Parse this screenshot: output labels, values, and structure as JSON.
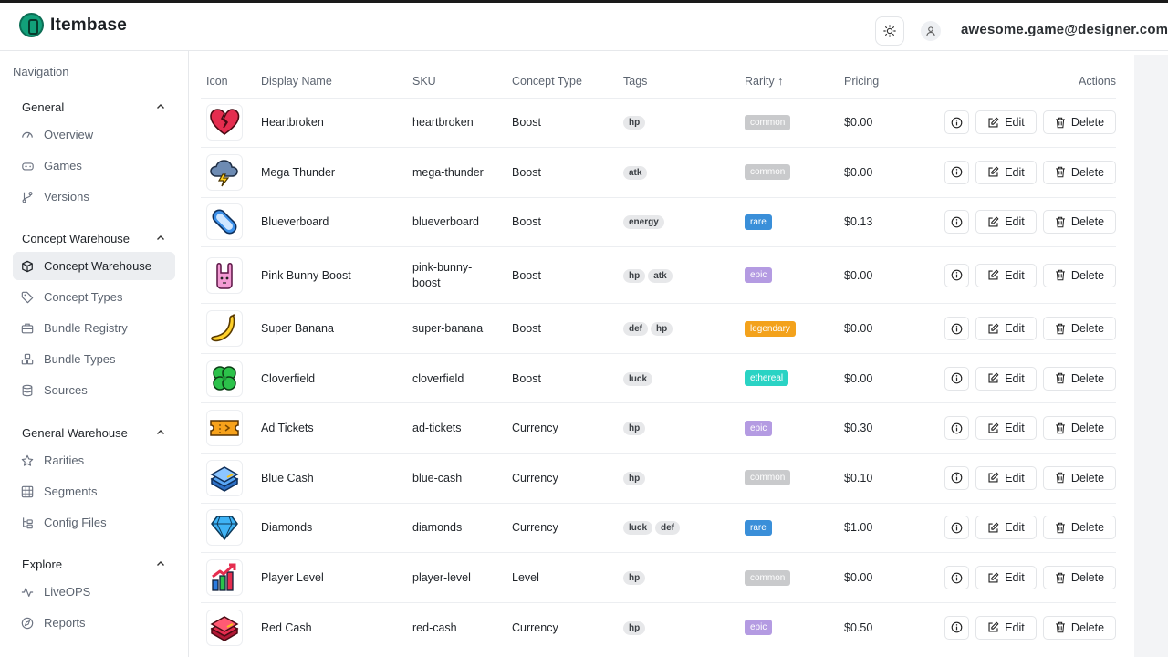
{
  "app": {
    "name": "Itembase",
    "user_email": "awesome.game@designer.com"
  },
  "nav": {
    "title": "Navigation",
    "sections": [
      {
        "label": "General",
        "items": [
          {
            "label": "Overview",
            "icon": "gauge-icon"
          },
          {
            "label": "Games",
            "icon": "gamepad-icon"
          },
          {
            "label": "Versions",
            "icon": "git-branch-icon"
          }
        ]
      },
      {
        "label": "Concept Warehouse",
        "items": [
          {
            "label": "Concept Warehouse",
            "icon": "cube-icon",
            "active": true
          },
          {
            "label": "Concept Types",
            "icon": "tag-icon"
          },
          {
            "label": "Bundle Registry",
            "icon": "briefcase-icon"
          },
          {
            "label": "Bundle Types",
            "icon": "boxes-icon"
          },
          {
            "label": "Sources",
            "icon": "database-icon"
          }
        ]
      },
      {
        "label": "General Warehouse",
        "items": [
          {
            "label": "Rarities",
            "icon": "star-icon"
          },
          {
            "label": "Segments",
            "icon": "grid-icon"
          },
          {
            "label": "Config Files",
            "icon": "file-tree-icon"
          }
        ]
      },
      {
        "label": "Explore",
        "items": [
          {
            "label": "LiveOPS",
            "icon": "activity-icon"
          },
          {
            "label": "Reports",
            "icon": "compass-icon"
          }
        ]
      }
    ]
  },
  "table": {
    "columns": {
      "icon": "Icon",
      "name": "Display Name",
      "sku": "SKU",
      "type": "Concept Type",
      "tags": "Tags",
      "rarity": "Rarity ↑",
      "pricing": "Pricing",
      "actions": "Actions"
    },
    "actions": {
      "edit": "Edit",
      "delete": "Delete"
    },
    "rows": [
      {
        "name": "Heartbroken",
        "sku": "heartbroken",
        "type": "Boost",
        "tags": [
          "hp"
        ],
        "rarity": "common",
        "price": "$0.00",
        "icon": "broken-heart-icon"
      },
      {
        "name": "Mega Thunder",
        "sku": "mega-thunder",
        "type": "Boost",
        "tags": [
          "atk"
        ],
        "rarity": "common",
        "price": "$0.00",
        "icon": "thunder-cloud-icon"
      },
      {
        "name": "Blueverboard",
        "sku": "blueverboard",
        "type": "Boost",
        "tags": [
          "energy"
        ],
        "rarity": "rare",
        "price": "$0.13",
        "icon": "hoverboard-icon"
      },
      {
        "name": "Pink Bunny Boost",
        "sku": "pink-bunny-boost",
        "sku_lines": [
          "pink-bunny-",
          "boost"
        ],
        "type": "Boost",
        "tags": [
          "hp",
          "atk"
        ],
        "rarity": "epic",
        "price": "$0.00",
        "icon": "bunny-icon"
      },
      {
        "name": "Super Banana",
        "sku": "super-banana",
        "type": "Boost",
        "tags": [
          "def",
          "hp"
        ],
        "rarity": "legendary",
        "price": "$0.00",
        "icon": "banana-icon"
      },
      {
        "name": "Cloverfield",
        "sku": "cloverfield",
        "type": "Boost",
        "tags": [
          "luck"
        ],
        "rarity": "ethereal",
        "price": "$0.00",
        "icon": "clover-icon"
      },
      {
        "name": "Ad Tickets",
        "sku": "ad-tickets",
        "type": "Currency",
        "tags": [
          "hp"
        ],
        "rarity": "epic",
        "price": "$0.30",
        "icon": "ticket-icon"
      },
      {
        "name": "Blue Cash",
        "sku": "blue-cash",
        "type": "Currency",
        "tags": [
          "hp"
        ],
        "rarity": "common",
        "price": "$0.10",
        "icon": "blue-cash-icon"
      },
      {
        "name": "Diamonds",
        "sku": "diamonds",
        "type": "Currency",
        "tags": [
          "luck",
          "def"
        ],
        "rarity": "rare",
        "price": "$1.00",
        "icon": "diamond-icon"
      },
      {
        "name": "Player Level",
        "sku": "player-level",
        "type": "Level",
        "tags": [
          "hp"
        ],
        "rarity": "common",
        "price": "$0.00",
        "icon": "level-chart-icon"
      },
      {
        "name": "Red Cash",
        "sku": "red-cash",
        "type": "Currency",
        "tags": [
          "hp"
        ],
        "rarity": "epic",
        "price": "$0.50",
        "icon": "red-cash-icon"
      }
    ]
  },
  "colors": {
    "common": "#c9cacc",
    "rare": "#3a8fd9",
    "epic": "#b49be2",
    "legendary": "#f3a21c",
    "ethereal": "#2ad3c4"
  }
}
